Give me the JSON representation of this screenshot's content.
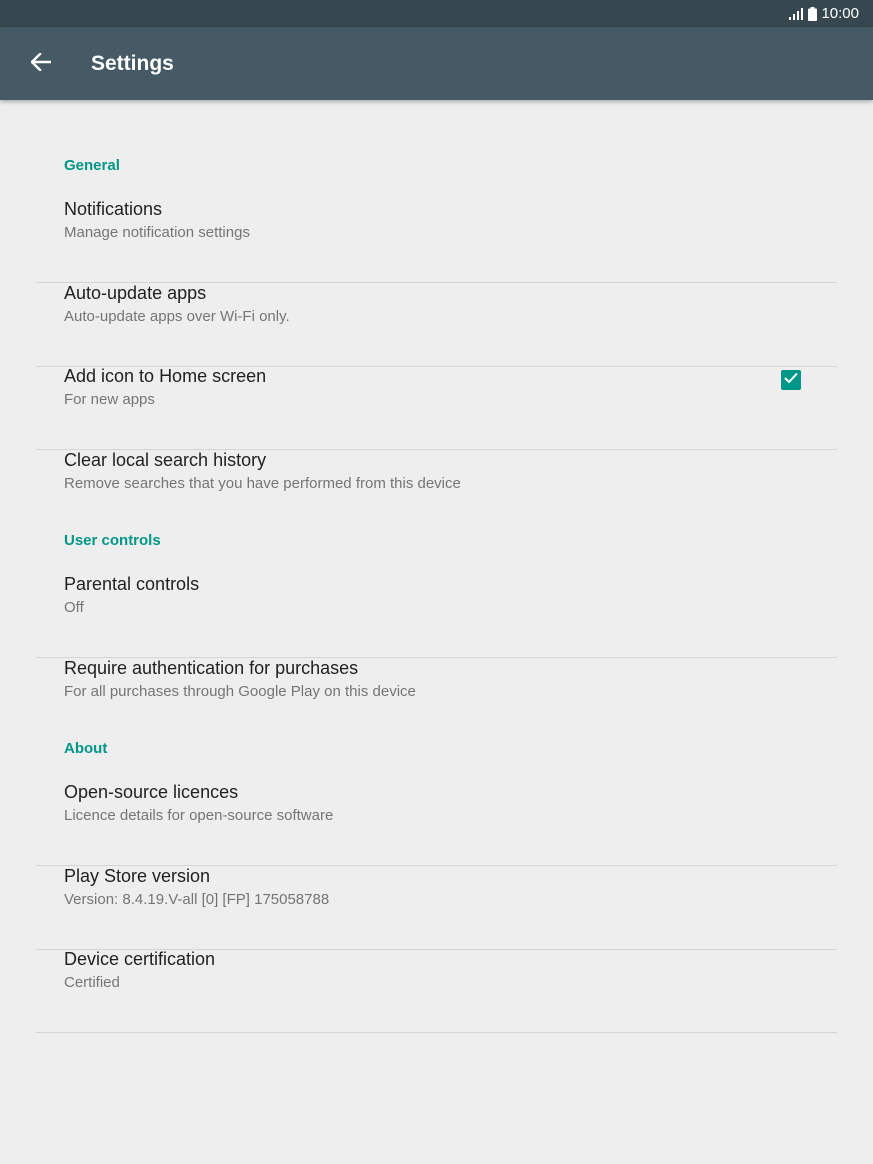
{
  "status_bar": {
    "time": "10:00",
    "icons": [
      "signal-icon",
      "battery-icon"
    ]
  },
  "app_bar": {
    "title": "Settings",
    "back_icon": "arrow-back-icon"
  },
  "colors": {
    "status_bar": "#37474f",
    "app_bar": "#455a64",
    "accent": "#009688",
    "background": "#eeeeee"
  },
  "sections": [
    {
      "header": "General",
      "items": [
        {
          "title": "Notifications",
          "subtitle": "Manage notification settings"
        },
        {
          "title": "Auto-update apps",
          "subtitle": "Auto-update apps over Wi-Fi only."
        },
        {
          "title": "Add icon to Home screen",
          "subtitle": "For new apps",
          "checkbox": true
        },
        {
          "title": "Clear local search history",
          "subtitle": "Remove searches that you have performed from this device"
        }
      ]
    },
    {
      "header": "User controls",
      "items": [
        {
          "title": "Parental controls",
          "subtitle": "Off"
        },
        {
          "title": "Require authentication for purchases",
          "subtitle": "For all purchases through Google Play on this device"
        }
      ]
    },
    {
      "header": "About",
      "items": [
        {
          "title": "Open-source licences",
          "subtitle": "Licence details for open-source software"
        },
        {
          "title": "Play Store version",
          "subtitle": "Version: 8.4.19.V-all [0] [FP] 175058788"
        },
        {
          "title": "Device certification",
          "subtitle": "Certified"
        }
      ]
    }
  ]
}
